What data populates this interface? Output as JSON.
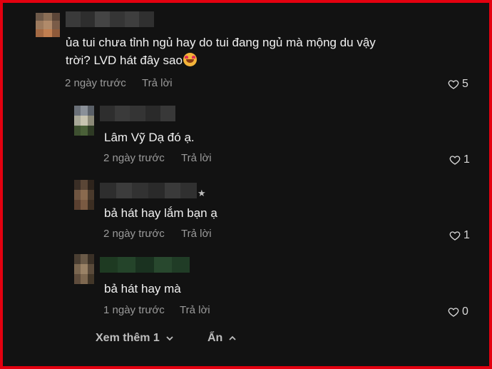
{
  "comment": {
    "text": "ủa tui chưa tỉnh ngủ hay do tui đang ngủ mà mộng du vậy trời? LVD hát đây sao",
    "text_line1": "ủa tui chưa tỉnh ngủ hay do tui đang ngủ mà mộng du vậy",
    "text_line2": "trời? LVD hát đây sao",
    "emoji": "smiling-face-with-hearts-emoji",
    "time": "2 ngày trước",
    "reply_label": "Trả lời",
    "likes": "5"
  },
  "replies": [
    {
      "text": "Lâm Vỹ Dạ đó ạ.",
      "time": "2 ngày trước",
      "reply_label": "Trả lời",
      "likes": "1"
    },
    {
      "text": "bả hát hay lắm bạn ạ",
      "time": "2 ngày trước",
      "reply_label": "Trả lời",
      "likes": "1",
      "badge": "★"
    },
    {
      "text": "bả hát hay mà",
      "time": "1 ngày trước",
      "reply_label": "Trả lời",
      "likes": "0"
    }
  ],
  "footer": {
    "see_more_label": "Xem thêm 1",
    "hide_label": "Ẩn"
  },
  "colors": {
    "border": "#e3000f",
    "background": "#121212",
    "text": "#f1f1f1",
    "muted": "#9a9a9a"
  },
  "icons": [
    "heart-icon",
    "chevron-down-icon",
    "chevron-up-icon",
    "star-icon"
  ]
}
